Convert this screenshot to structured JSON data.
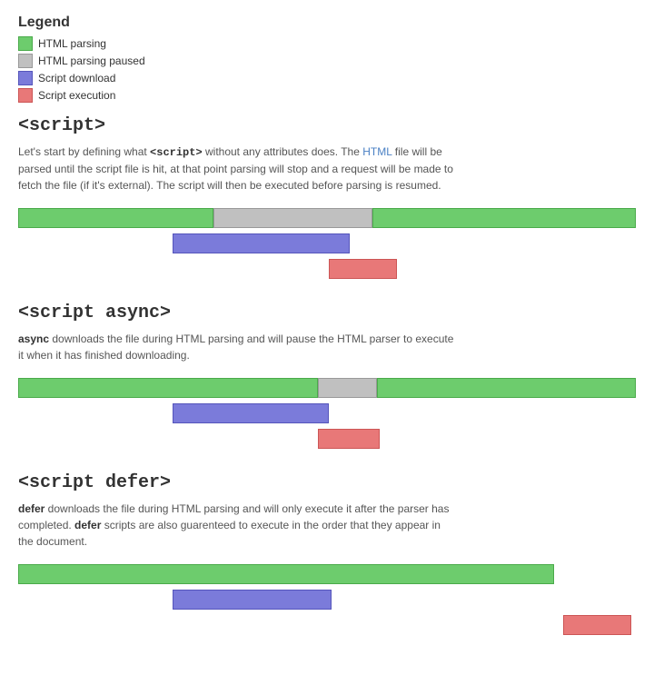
{
  "legend": {
    "title": "Legend",
    "items": [
      {
        "label": "HTML parsing",
        "color": "green"
      },
      {
        "label": "HTML parsing paused",
        "color": "gray"
      },
      {
        "label": "Script download",
        "color": "blue"
      },
      {
        "label": "Script execution",
        "color": "red"
      }
    ]
  },
  "sections": [
    {
      "id": "script",
      "heading": "<script>",
      "description_parts": [
        {
          "type": "text",
          "text": "Let's start by defining what "
        },
        {
          "type": "code",
          "text": "<script>"
        },
        {
          "type": "text",
          "text": " without any attributes does. The "
        },
        {
          "type": "link",
          "text": "HTML"
        },
        {
          "type": "text",
          "text": " file will be parsed until the script file is hit, at that point parsing will stop and a request will be made to fetch the file (if it's external). The script will then be executed before parsing is resumed."
        }
      ]
    },
    {
      "id": "script-async",
      "heading": "<script async>",
      "description_parts": [
        {
          "type": "bold",
          "text": "async"
        },
        {
          "type": "text",
          "text": " downloads the file during HTML parsing and will pause the HTML parser to execute it when it has finished downloading."
        }
      ]
    },
    {
      "id": "script-defer",
      "heading": "<script defer>",
      "description_parts": [
        {
          "type": "bold",
          "text": "defer"
        },
        {
          "type": "text",
          "text": " downloads the file during HTML parsing and will only execute it after the parser has completed. "
        },
        {
          "type": "bold",
          "text": "defer"
        },
        {
          "type": "text",
          "text": " scripts are also guarenteed to execute in the order that they appear in the document."
        }
      ]
    }
  ]
}
